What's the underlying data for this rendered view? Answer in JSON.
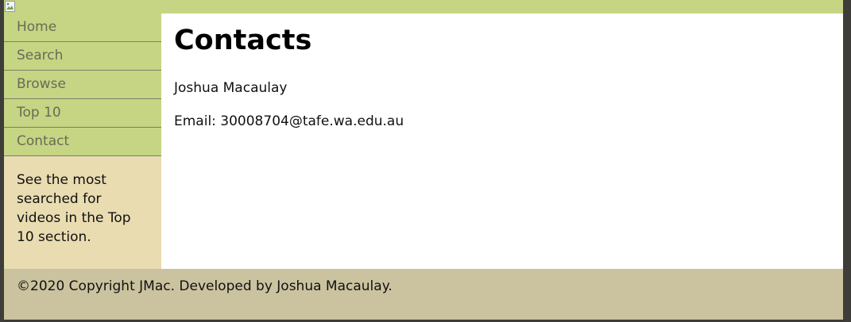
{
  "header": {
    "logo_icon": "broken-image-icon"
  },
  "sidebar": {
    "items": [
      {
        "label": "Home"
      },
      {
        "label": "Search"
      },
      {
        "label": "Browse"
      },
      {
        "label": "Top 10"
      },
      {
        "label": "Contact"
      }
    ],
    "note": "See the most searched for videos in the Top 10 section."
  },
  "main": {
    "title": "Contacts",
    "name": "Joshua Macaulay",
    "email": "Email: 30008704@tafe.wa.edu.au"
  },
  "footer": {
    "text": "©2020 Copyright JMac. Developed by Joshua Macaulay."
  },
  "colors": {
    "nav_bg": "#c5d583",
    "sidebar_bg": "#e9dcb1",
    "footer_bg": "#cbc39f",
    "frame_bg": "#3f3d39"
  }
}
